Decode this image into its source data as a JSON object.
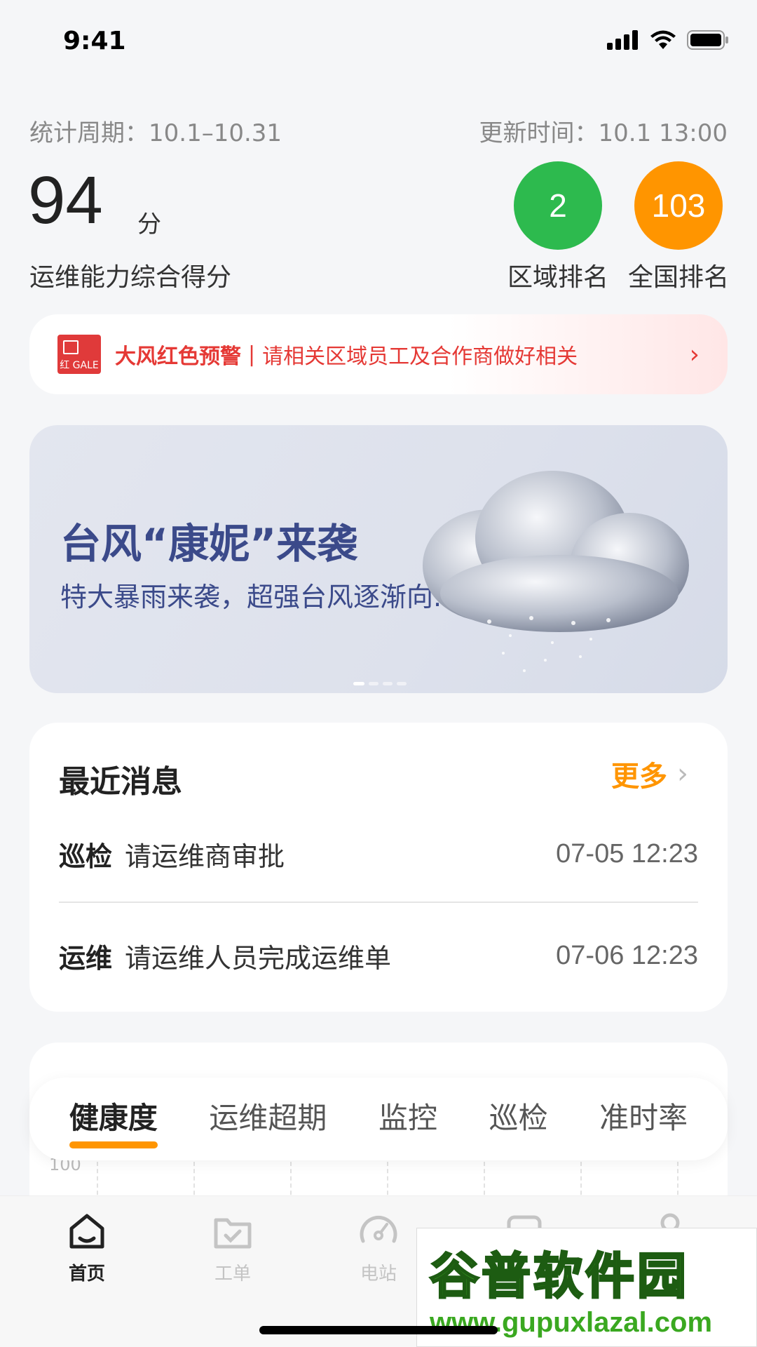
{
  "status_bar": {
    "time": "9:41"
  },
  "header": {
    "period": "统计周期：10.1–10.31",
    "updated": "更新时间：10.1 13:00",
    "score": "94",
    "score_unit": "分",
    "score_label": "运维能力综合得分",
    "regional_rank": "2",
    "regional_rank_label": "区域排名",
    "national_rank": "103",
    "national_rank_label": "全国排名",
    "colors": {
      "regional": "#2dba4e",
      "national": "#ff9500"
    }
  },
  "warning": {
    "badge_text": "红 GALE",
    "title": "大风红色预警",
    "separator": "|",
    "text": "请相关区域员工及合作商做好相关",
    "color": "#e53935"
  },
  "typhoon": {
    "title": "台风“康妮”来袭",
    "subtitle": "特大暴雨来袭，超强台风逐渐向...",
    "slides": 4,
    "active_slide": 1
  },
  "messages": {
    "title": "最近消息",
    "more_label": "更多",
    "items": [
      {
        "tag": "巡检",
        "text": "请运维商审批",
        "datetime": "07-05 12:23"
      },
      {
        "tag": "运维",
        "text": "请运维人员完成运维单",
        "datetime": "07-06 12:23"
      }
    ]
  },
  "health_card": {
    "y_tick": "100"
  },
  "tabs": [
    {
      "label": "健康度",
      "active": true
    },
    {
      "label": "运维超期",
      "active": false
    },
    {
      "label": "监控",
      "active": false
    },
    {
      "label": "巡检",
      "active": false
    },
    {
      "label": "准时率",
      "active": false
    }
  ],
  "bottom_nav": [
    {
      "label": "首页",
      "icon": "home-icon",
      "active": true
    },
    {
      "label": "工单",
      "icon": "folder-check-icon",
      "active": false
    },
    {
      "label": "电站",
      "icon": "gauge-icon",
      "active": false
    },
    {
      "label": "",
      "icon": "device-icon",
      "active": false
    },
    {
      "label": "",
      "icon": "user-icon",
      "active": false
    }
  ],
  "watermark": {
    "main": "谷普软件园",
    "url": "www.gupuxlazal.com"
  }
}
